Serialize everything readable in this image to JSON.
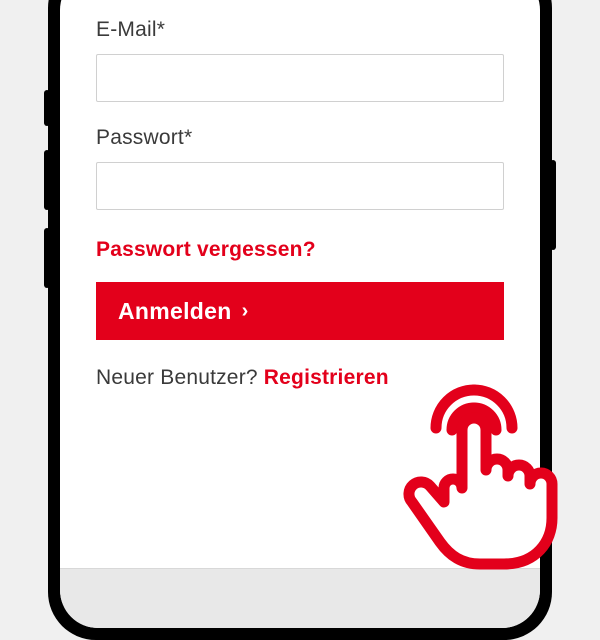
{
  "form": {
    "email_label": "E-Mail*",
    "password_label": "Passwort*",
    "forgot_password": "Passwort vergessen?",
    "login_button": "Anmelden",
    "new_user_text": "Neuer Benutzer? ",
    "register_link": "Registrieren"
  },
  "colors": {
    "accent": "#e3001b"
  }
}
